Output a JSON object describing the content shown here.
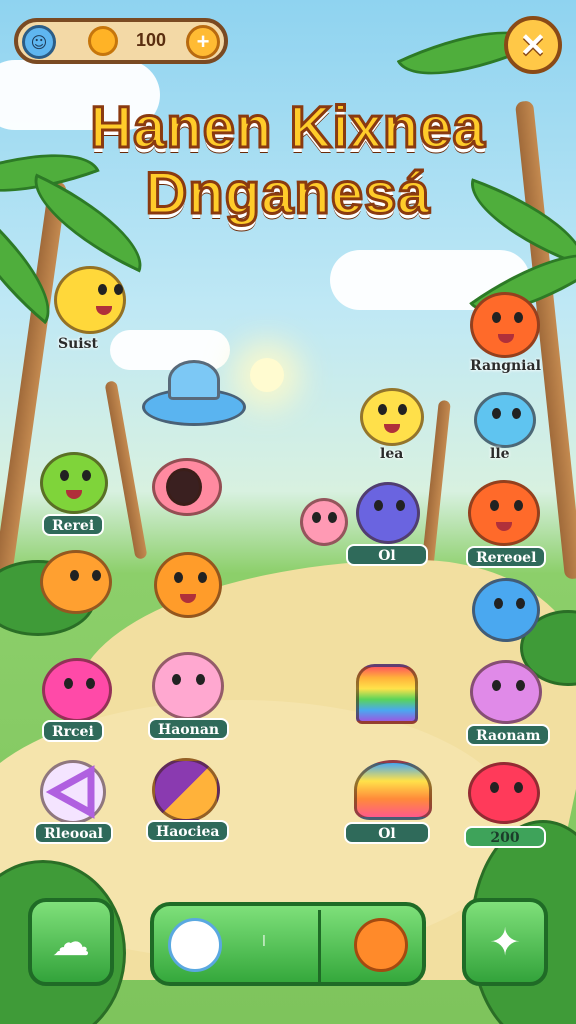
{
  "hud": {
    "coin_value": "100",
    "plus_symbol": "+",
    "avatar_icon": "blue-creature-avatar-icon",
    "coin_icon": "coin-icon",
    "close_symbol": "✕"
  },
  "title": {
    "line1": "Hanen Kixnea",
    "line2": "Dnganesá"
  },
  "creatures": [
    {
      "id": "yellow-bunny",
      "label": "Suist",
      "color": "#ffd83a"
    },
    {
      "id": "ufo",
      "label": "",
      "color": "#5ab4f0"
    },
    {
      "id": "orange-blob",
      "label": "Rangnial",
      "color": "#ff6a2a"
    },
    {
      "id": "yellow-blob",
      "label": "lea",
      "color": "#ffe04a"
    },
    {
      "id": "blue-blob-star",
      "label": "lle",
      "color": "#5fc4f0"
    },
    {
      "id": "green-frog",
      "label": "Rerei",
      "color": "#7fd43a"
    },
    {
      "id": "horn",
      "label": "",
      "color": "#ff8aa0"
    },
    {
      "id": "pink-cat",
      "label": "",
      "color": "#ff9ab4"
    },
    {
      "id": "purple-ball",
      "label": "Ol",
      "color": "#6a64e0"
    },
    {
      "id": "orange-ball",
      "label": "Rereoel",
      "color": "#ff6a2a"
    },
    {
      "id": "orange-fish",
      "label": "",
      "color": "#ffa030"
    },
    {
      "id": "orange-smiley",
      "label": "",
      "color": "#ff9c2a"
    },
    {
      "id": "blue-ball",
      "label": "",
      "color": "#4aa8f0"
    },
    {
      "id": "pink-mouse",
      "label": "Rrcei",
      "color": "#ff4aa8"
    },
    {
      "id": "pink-fluffy",
      "label": "Haonan",
      "color": "#ffa8d0"
    },
    {
      "id": "rainbow-cone",
      "label": "",
      "color": "#ff6a6a"
    },
    {
      "id": "purple-mouse",
      "label": "Raonam",
      "color": "#e08ae8"
    },
    {
      "id": "purple-triangle",
      "label": "Rleooal",
      "color": "#b060e0"
    },
    {
      "id": "purple-orb",
      "label": "Haociea",
      "color": "#8a3ab0"
    },
    {
      "id": "rainbow-jelly",
      "label": "Ol",
      "color": "#ffb23a"
    },
    {
      "id": "red-blob",
      "label": "200",
      "color": "#ff3a5a"
    }
  ],
  "bottom": {
    "left_icon": "cloud-creature-icon",
    "bar_left_icon": "white-flower-creature-icon",
    "bar_divider_text": "l",
    "bar_right_icon": "orange-creature-icon",
    "right_icon": "star-arrow-icon"
  }
}
